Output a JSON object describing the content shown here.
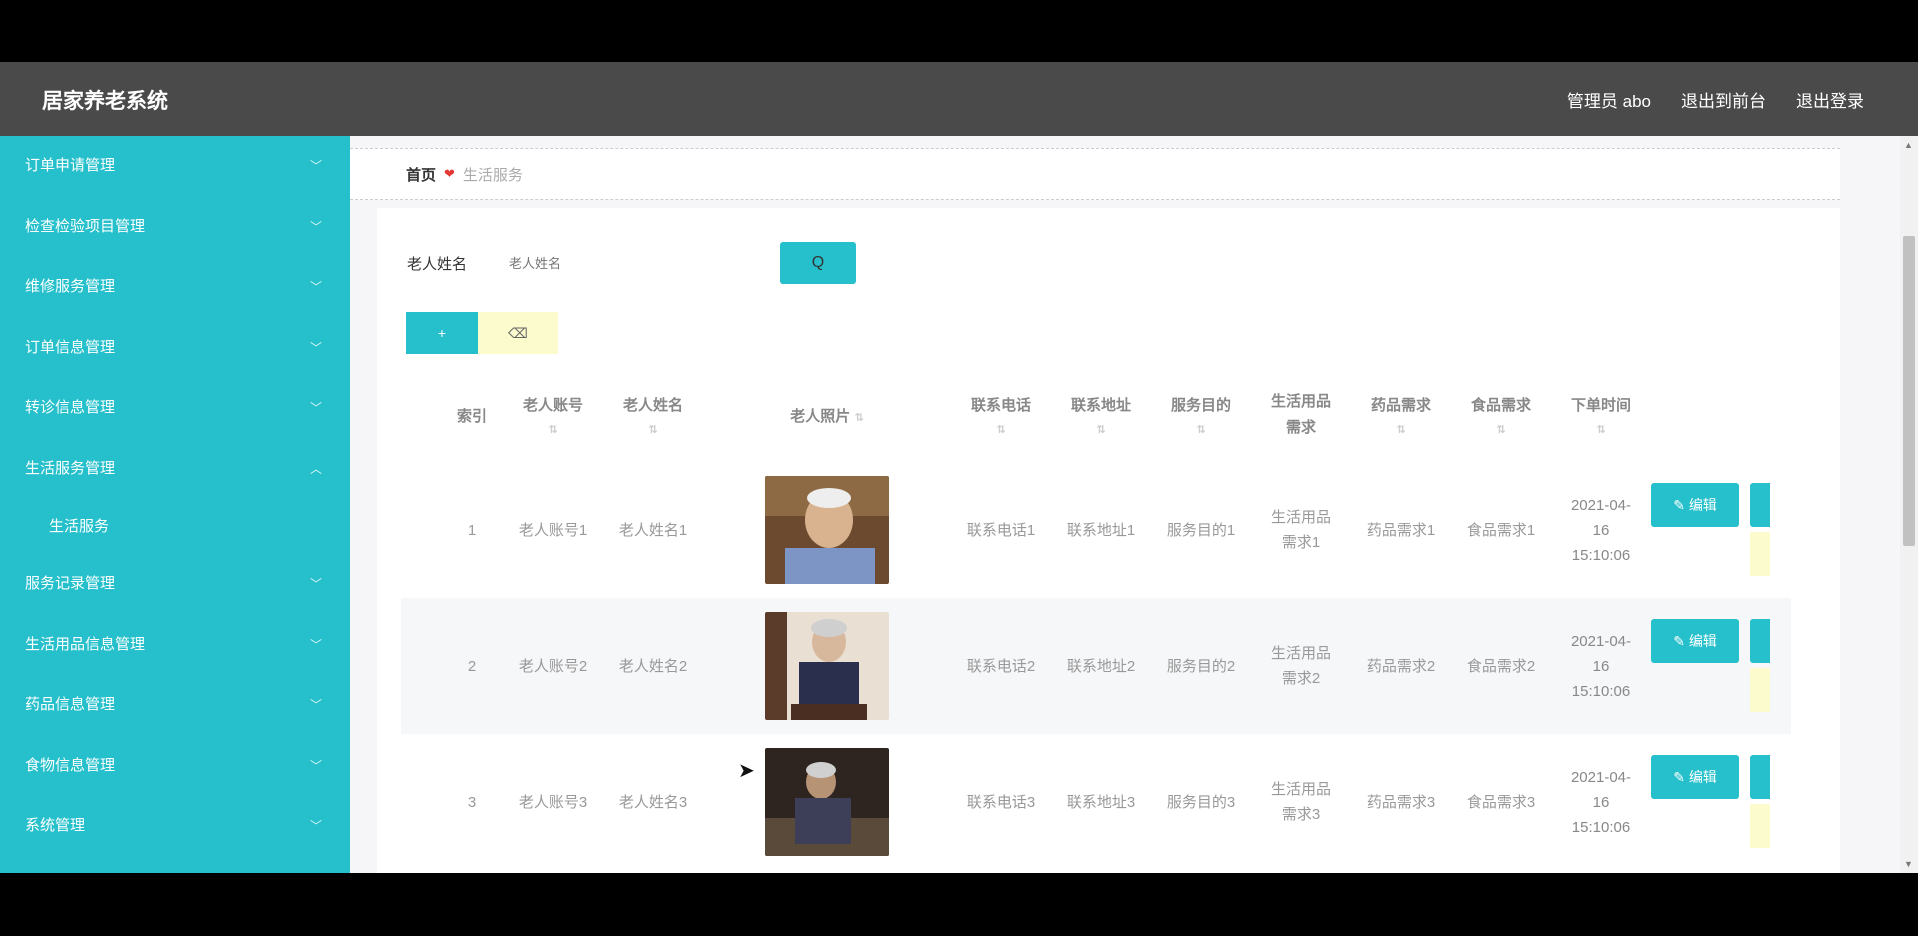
{
  "app": {
    "title": "居家养老系统"
  },
  "topnav": {
    "user": "管理员 abo",
    "front": "退出到前台",
    "logout": "退出登录"
  },
  "sidebar": {
    "items": [
      {
        "label": "订单申请管理"
      },
      {
        "label": "检查检验项目管理"
      },
      {
        "label": "维修服务管理"
      },
      {
        "label": "订单信息管理"
      },
      {
        "label": "转诊信息管理"
      },
      {
        "label": "生活服务管理",
        "expanded": true,
        "children": [
          {
            "label": "生活服务"
          }
        ]
      },
      {
        "label": "服务记录管理"
      },
      {
        "label": "生活用品信息管理"
      },
      {
        "label": "药品信息管理"
      },
      {
        "label": "食物信息管理"
      },
      {
        "label": "系统管理"
      }
    ]
  },
  "breadcrumb": {
    "home": "首页",
    "separator": "❤",
    "current": "生活服务"
  },
  "search": {
    "label": "老人姓名",
    "placeholder": "老人姓名",
    "button": "Q"
  },
  "actions": {
    "add": "+",
    "delete": "⌫"
  },
  "table": {
    "columns": [
      "索引",
      "老人账号",
      "老人姓名",
      "老人照片",
      "联系电话",
      "联系地址",
      "服务目的",
      "生活用品需求",
      "药品需求",
      "食品需求",
      "下单时间"
    ],
    "rows": [
      {
        "index": "1",
        "account": "老人账号1",
        "name": "老人姓名1",
        "phone": "联系电话1",
        "address": "联系地址1",
        "purpose": "服务目的1",
        "goods": "生活用品需求1",
        "medicine": "药品需求1",
        "food": "食品需求1",
        "time": "2021-04-16 15:10:06",
        "edit": "编辑"
      },
      {
        "index": "2",
        "account": "老人账号2",
        "name": "老人姓名2",
        "phone": "联系电话2",
        "address": "联系地址2",
        "purpose": "服务目的2",
        "goods": "生活用品需求2",
        "medicine": "药品需求2",
        "food": "食品需求2",
        "time": "2021-04-16 15:10:06",
        "edit": "编辑"
      },
      {
        "index": "3",
        "account": "老人账号3",
        "name": "老人姓名3",
        "phone": "联系电话3",
        "address": "联系地址3",
        "purpose": "服务目的3",
        "goods": "生活用品需求3",
        "medicine": "药品需求3",
        "food": "食品需求3",
        "time": "2021-04-16 15:10:06",
        "edit": "编辑"
      }
    ]
  },
  "colors": {
    "accent": "#25c0cb",
    "topbar": "#4a4a4a",
    "warning": "#fbfbcd"
  }
}
